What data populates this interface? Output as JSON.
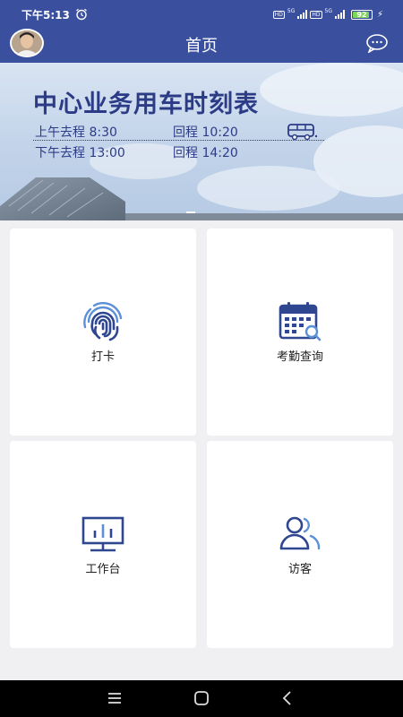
{
  "status_bar": {
    "time": "下午5:13",
    "hd_label": "HD",
    "network_label": "5G",
    "battery": "92",
    "battery_level": 0.92
  },
  "nav": {
    "title": "首页"
  },
  "banner": {
    "title": "中心业务用车时刻表",
    "row1_left": "上午去程 8:30",
    "row1_right": "回程 10:20",
    "row2_left": "下午去程 13:00",
    "row2_right": "回程 14:20"
  },
  "tiles": [
    {
      "label": "打卡",
      "icon": "fingerprint-icon"
    },
    {
      "label": "考勤查询",
      "icon": "calendar-search-icon"
    },
    {
      "label": "工作台",
      "icon": "monitor-chart-icon"
    },
    {
      "label": "访客",
      "icon": "visitors-icon"
    }
  ],
  "colors": {
    "header": "#3a4f9e",
    "accent": "#2c3b86",
    "icon_blue": "#2f4690",
    "icon_light": "#5b8fd8",
    "background": "#f0f0f2"
  }
}
